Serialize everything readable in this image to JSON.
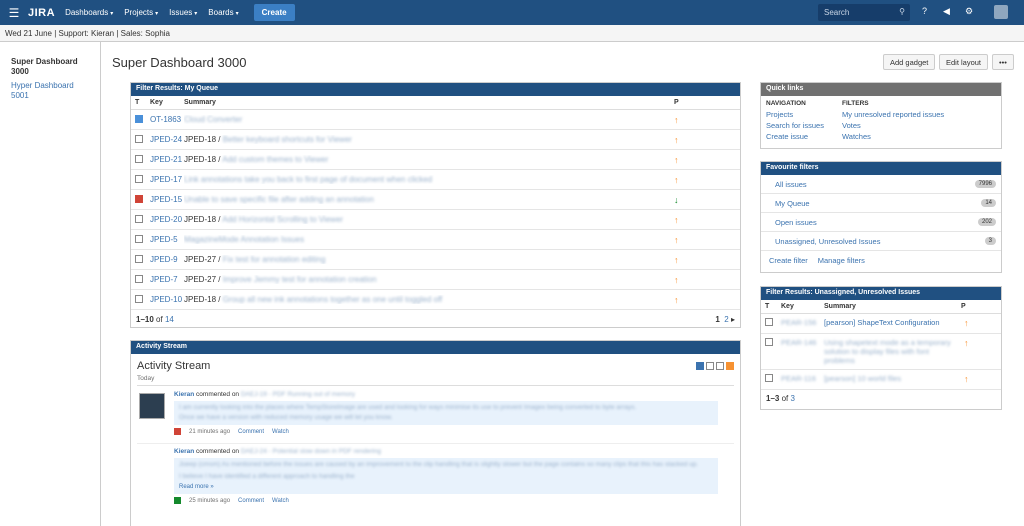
{
  "topbar": {
    "logo": "JIRA",
    "nav": [
      "Dashboards",
      "Projects",
      "Issues",
      "Boards"
    ],
    "create_label": "Create",
    "search_placeholder": "Search"
  },
  "status_line": "Wed 21 June | Support: Kieran | Sales: Sophia",
  "sidebar": {
    "current": "Super Dashboard 3000",
    "other": "Hyper Dashboard 5001"
  },
  "page": {
    "title": "Super Dashboard 3000",
    "add_gadget": "Add gadget",
    "edit_layout": "Edit layout",
    "more": "•••"
  },
  "my_queue": {
    "header": "Filter Results: My Queue",
    "columns": [
      "T",
      "Key",
      "Summary",
      "P"
    ],
    "rows": [
      {
        "type": "subtask",
        "key": "OT-1863",
        "parent": "",
        "summary": "Cloud Converter",
        "pri": "↑",
        "pri_color": "#f79232"
      },
      {
        "type": "story",
        "key": "JPED-24",
        "parent": "JPED-18 /",
        "summary": "Better keyboard shortcuts for Viewer",
        "pri": "↑",
        "pri_color": "#f79232"
      },
      {
        "type": "story",
        "key": "JPED-21",
        "parent": "JPED-18 /",
        "summary": "Add custom themes to Viewer",
        "pri": "↑",
        "pri_color": "#f79232"
      },
      {
        "type": "improvement",
        "key": "JPED-17",
        "parent": "",
        "summary": "Link annotations take you back to first page of document when clicked",
        "pri": "↑",
        "pri_color": "#f79232"
      },
      {
        "type": "bug",
        "key": "JPED-15",
        "parent": "",
        "summary": "Unable to save specific file after adding an annotation",
        "pri": "↓",
        "pri_color": "#14892c"
      },
      {
        "type": "story",
        "key": "JPED-20",
        "parent": "JPED-18 /",
        "summary": "Add Horizontal Scrolling to Viewer",
        "pri": "↑",
        "pri_color": "#f79232"
      },
      {
        "type": "improvement",
        "key": "JPED-5",
        "parent": "",
        "summary": "MagazineMode Annotation Issues",
        "pri": "↑",
        "pri_color": "#f79232"
      },
      {
        "type": "story",
        "key": "JPED-9",
        "parent": "JPED-27 /",
        "summary": "Fix test for annotation editing",
        "pri": "↑",
        "pri_color": "#f79232"
      },
      {
        "type": "story",
        "key": "JPED-7",
        "parent": "JPED-27 /",
        "summary": "Improve Jemmy test for annotation creation",
        "pri": "↑",
        "pri_color": "#f79232"
      },
      {
        "type": "story",
        "key": "JPED-10",
        "parent": "JPED-18 /",
        "summary": "Group all new ink annotations together as one until toggled off",
        "pri": "↑",
        "pri_color": "#f79232"
      }
    ],
    "range": "1–10",
    "of": "of",
    "total": "14",
    "page_1": "1",
    "page_2": "2",
    "next": "▸"
  },
  "activity": {
    "header": "Activity Stream",
    "title": "Activity Stream",
    "today": "Today",
    "items": [
      {
        "user": "Kieran",
        "verb": "commented on",
        "issue": "DAEJ-19 - PDF Running out of memory",
        "line1": "I am currently looking into the places where TempStoreImage are used and looking for ways minimise its use to prevent Imagex being converted to byte arrays.",
        "line2": "Once we have a version with reduced memory usage we will let you know.",
        "time": "21 minutes ago",
        "comment": "Comment",
        "watch": "Watch"
      },
      {
        "user": "Kieran",
        "verb": "commented on",
        "issue": "DAEJ-24 - Potential slow down in PDF rendering",
        "mention": "Joeep (cmsm)",
        "line1": "As mentioned before the issues are caused by an improvement to the clip handling that is slightly slower but the page contains so many clips that this has stacked up.",
        "line2": "I believe I have identified a different approach to handling the",
        "more": "Read more »",
        "time": "25 minutes ago",
        "comment": "Comment",
        "watch": "Watch"
      }
    ]
  },
  "quick_links": {
    "header": "Quick links",
    "nav_title": "NAVIGATION",
    "nav": [
      "Projects",
      "Search for issues",
      "Create issue"
    ],
    "filters_title": "FILTERS",
    "filters": [
      "My unresolved reported issues",
      "Votes",
      "Watches"
    ]
  },
  "fav_filters": {
    "header": "Favourite filters",
    "items": [
      {
        "name": "All issues",
        "count": "7996"
      },
      {
        "name": "My Queue",
        "count": "14"
      },
      {
        "name": "Open issues",
        "count": "202"
      },
      {
        "name": "Unassigned, Unresolved Issues",
        "count": "3"
      }
    ],
    "create": "Create filter",
    "manage": "Manage filters"
  },
  "unassigned": {
    "header": "Filter Results: Unassigned, Unresolved Issues",
    "columns": [
      "T",
      "Key",
      "Summary",
      "P"
    ],
    "rows": [
      {
        "key": "PEAR-156",
        "summary": "[pearson] ShapeText Configuration"
      },
      {
        "key": "PEAR-146",
        "summary": "Using shapetext mode as a temporary solution to display files with font problems"
      },
      {
        "key": "PEAR-116",
        "summary": "[pearson] 10 world files"
      }
    ],
    "range": "1–3",
    "of": "of",
    "total": "3"
  }
}
